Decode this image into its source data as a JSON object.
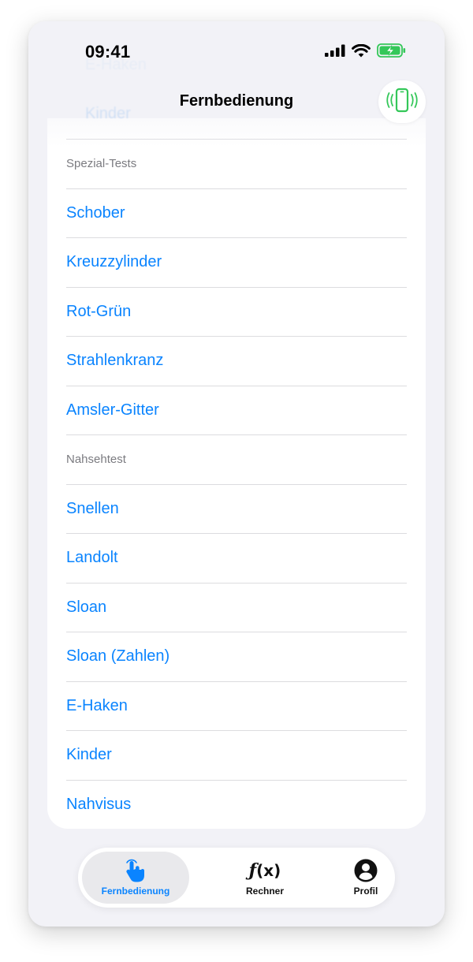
{
  "status_bar": {
    "time": "09:41",
    "icons": [
      "cellular-signal-icon",
      "wifi-icon",
      "battery-charging-icon"
    ]
  },
  "navbar": {
    "title": "Fernbedienung",
    "remote_icon": "phone-vibrating-icon",
    "background_text": [
      "E-Haken",
      "Kinder"
    ]
  },
  "list": {
    "sections": [
      {
        "header": "Spezial-Tests",
        "items": [
          "Schober",
          "Kreuzzylinder",
          "Rot-Grün",
          "Strahlenkranz",
          "Amsler-Gitter"
        ]
      },
      {
        "header": "Nahsehtest",
        "items": [
          "Snellen",
          "Landolt",
          "Sloan",
          "Sloan (Zahlen)",
          "E-Haken",
          "Kinder",
          "Nahvisus"
        ]
      }
    ]
  },
  "tab_bar": {
    "tabs": [
      {
        "label": "Fernbedienung",
        "icon": "hand-tap-icon",
        "active": true
      },
      {
        "label": "Rechner",
        "icon": "function-icon",
        "active": false
      },
      {
        "label": "Profil",
        "icon": "person-circle-icon",
        "active": false
      }
    ]
  },
  "colors": {
    "accent": "#0a84ff",
    "remote_icon": "#34c759",
    "background": "#f2f2f7"
  }
}
